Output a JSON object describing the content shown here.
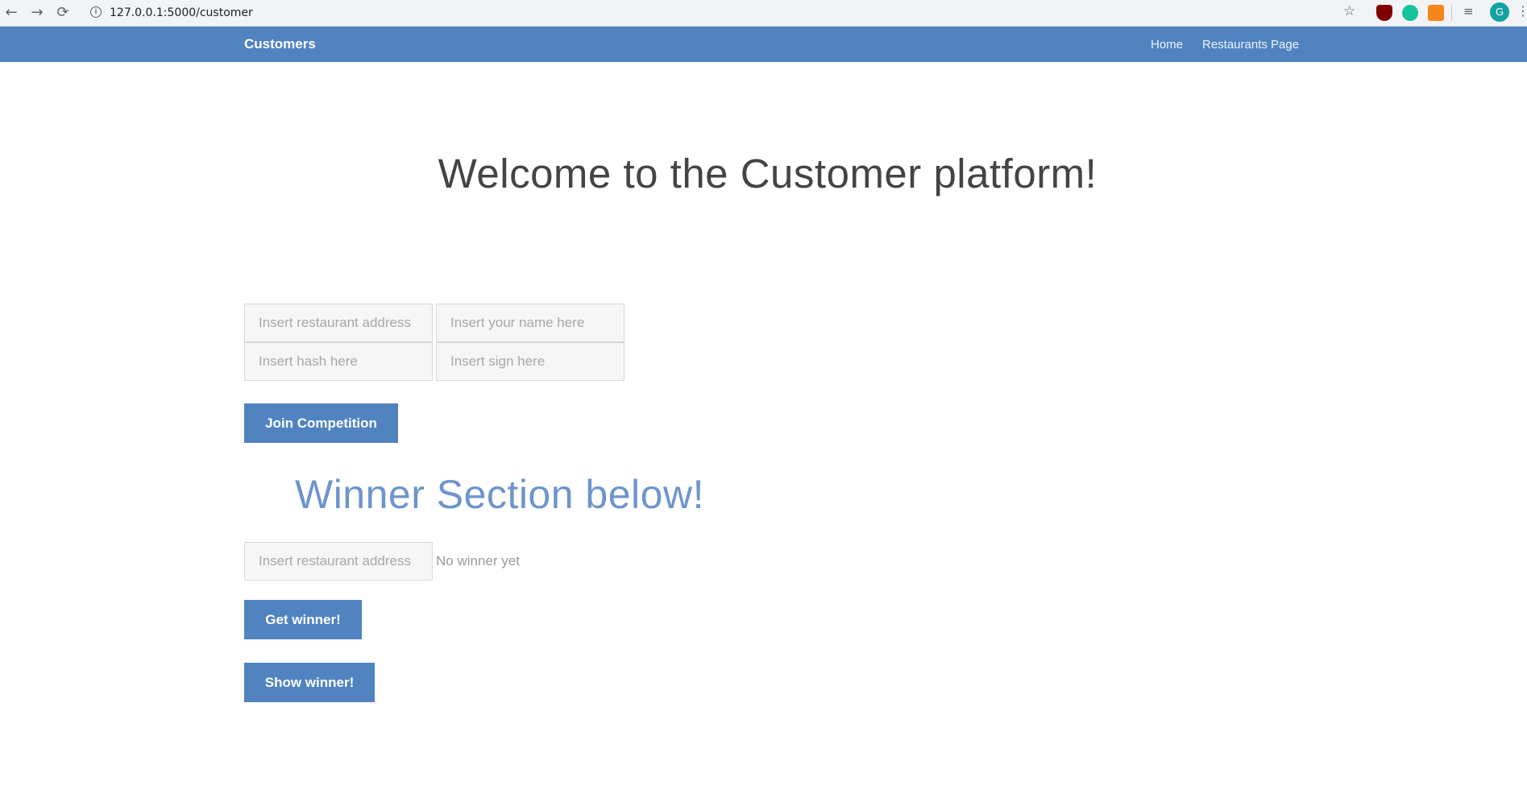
{
  "browser": {
    "url": "127.0.0.1:5000/customer",
    "profile_initial": "G",
    "back_icon": "←",
    "forward_icon": "→",
    "reload_icon": "⟳",
    "star_icon": "☆",
    "menu_icon": "⋮",
    "info_icon": "i",
    "queue_icon": "≡"
  },
  "navbar": {
    "brand": "Customers",
    "links": [
      "Home",
      "Restaurants Page"
    ],
    "color": "#5083c0"
  },
  "main": {
    "welcome_title": "Welcome to the Customer platform!",
    "competition_form": {
      "restaurant_address_placeholder": "Insert restaurant address",
      "name_placeholder": "Insert your name here",
      "hash_placeholder": "Insert hash here",
      "sign_placeholder": "Insert sign here",
      "join_button": "Join Competition"
    },
    "winner_section": {
      "title": "Winner Section below!",
      "restaurant_address_placeholder": "Insert restaurant address",
      "status_text": "No winner yet",
      "get_button": "Get winner!",
      "show_button": "Show winner!"
    }
  }
}
